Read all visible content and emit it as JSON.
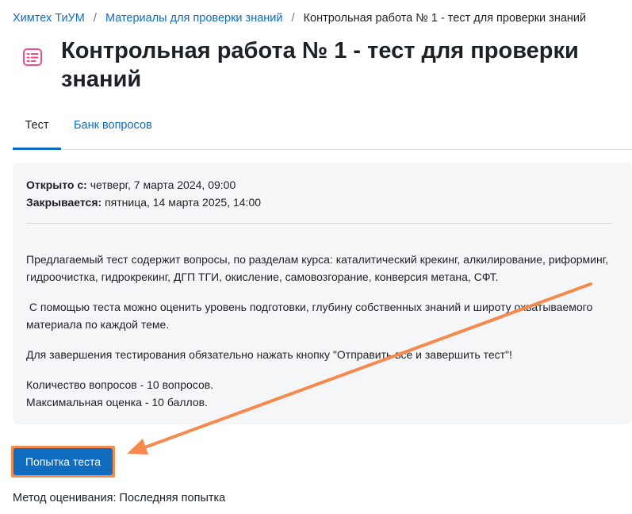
{
  "breadcrumb": {
    "items": [
      {
        "label": "Химтех ТиУМ"
      },
      {
        "label": "Материалы для проверки знаний"
      }
    ],
    "separator": "/",
    "current": "Контрольная работа № 1 - тест для проверки знаний"
  },
  "header": {
    "icon": "quiz-icon",
    "title": "Контрольная работа № 1 - тест для проверки знаний"
  },
  "tabs": [
    {
      "label": "Тест",
      "active": true
    },
    {
      "label": "Банк вопросов",
      "active": false
    }
  ],
  "dates": {
    "open_label": "Открыто с:",
    "open_value": "четверг, 7 марта 2024, 09:00",
    "close_label": "Закрывается:",
    "close_value": "пятница, 14 марта 2025, 14:00"
  },
  "description": {
    "p1": "Предлагаемый тест содержит вопросы, по разделам курса: каталитический крекинг, алкилирование, риформинг, гидроочистка, гидрокрекинг, ДГП ТГИ, окисление, самовозгорание, конверсия метана, СФТ.",
    "p2": " С помощью теста можно оценить уровень подготовки, глубину собственных знаний и широту охватываемого материала по каждой теме.",
    "p3": "Для завершения тестирования обязательно нажать кнопку \"Отправить все и завершить тест\"!",
    "p4_line1": "Количество вопросов - 10 вопросов.",
    "p4_line2": "Максимальная оценка - 10 баллов."
  },
  "attempt_button": {
    "label": "Попытка теста"
  },
  "grading": {
    "text": "Метод оценивания: Последняя попытка"
  },
  "colors": {
    "link": "#0f6cbf",
    "icon_accent": "#eb4f8a",
    "annotation": "#f58a4c",
    "box_bg": "#f5f6f7"
  }
}
